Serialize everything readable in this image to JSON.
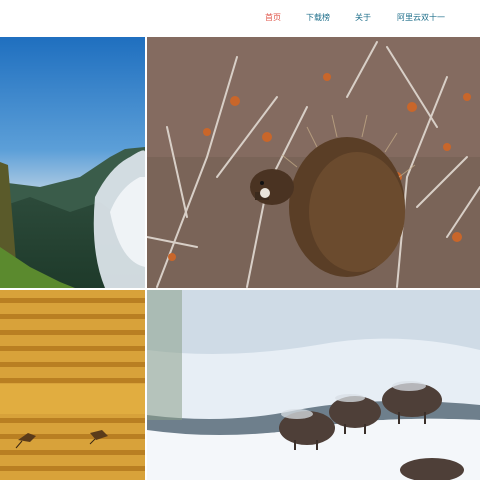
{
  "nav": {
    "items": [
      {
        "label": "首页",
        "active": true
      },
      {
        "label": "下载榜",
        "active": false
      },
      {
        "label": "关于",
        "active": false
      },
      {
        "label": "阿里云双十一",
        "active": false
      }
    ]
  },
  "gallery": {
    "photos": [
      {
        "subject": "mountain-valley-clouds"
      },
      {
        "subject": "porcupine-in-branches"
      },
      {
        "subject": "golden-terraced-fields"
      },
      {
        "subject": "bison-in-snow"
      }
    ]
  },
  "colors": {
    "nav_active": "#e0554a",
    "nav_link": "#1f6f8b"
  }
}
